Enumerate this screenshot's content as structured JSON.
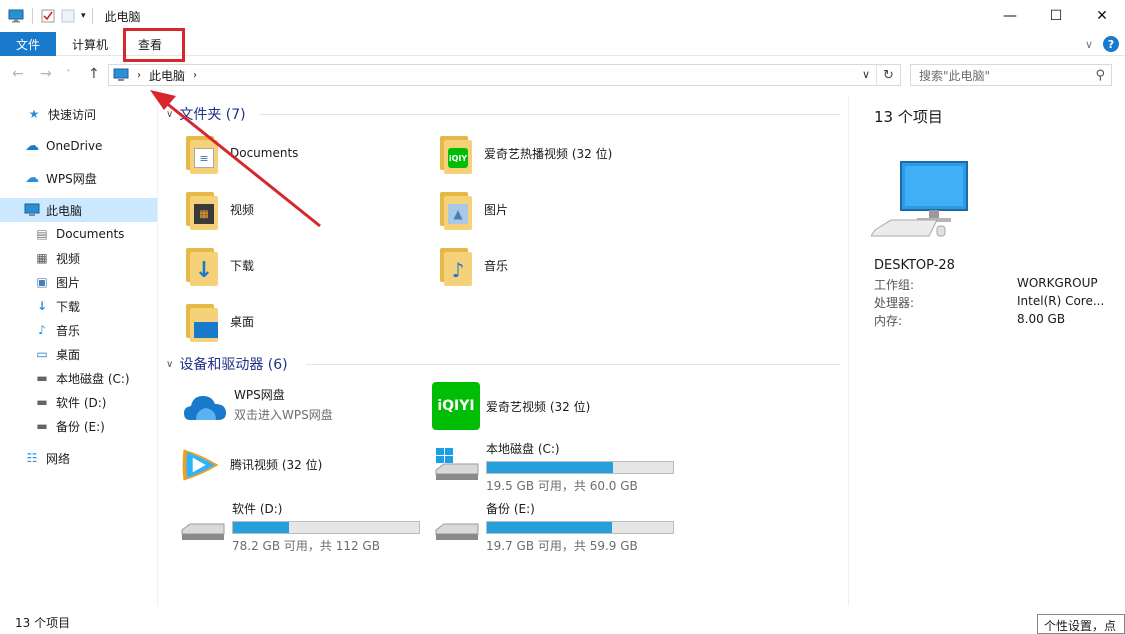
{
  "window": {
    "title": "此电脑"
  },
  "ribbon": {
    "tabs": [
      "文件",
      "计算机",
      "查看"
    ]
  },
  "address": {
    "path": "此电脑",
    "search_placeholder": "搜索\"此电脑\""
  },
  "sidebar": {
    "items": [
      {
        "label": "快速访问",
        "icon": "star-icon"
      },
      {
        "label": "OneDrive",
        "icon": "cloud-icon"
      },
      {
        "label": "WPS网盘",
        "icon": "cloud-icon"
      },
      {
        "label": "此电脑",
        "icon": "computer-icon"
      },
      {
        "label": "Documents",
        "icon": "document-icon"
      },
      {
        "label": "视频",
        "icon": "video-icon"
      },
      {
        "label": "图片",
        "icon": "image-icon"
      },
      {
        "label": "下载",
        "icon": "download-icon"
      },
      {
        "label": "音乐",
        "icon": "music-icon"
      },
      {
        "label": "桌面",
        "icon": "desktop-icon"
      },
      {
        "label": "本地磁盘 (C:)",
        "icon": "drive-icon"
      },
      {
        "label": "软件 (D:)",
        "icon": "drive-icon"
      },
      {
        "label": "备份 (E:)",
        "icon": "drive-icon"
      },
      {
        "label": "网络",
        "icon": "network-icon"
      }
    ]
  },
  "folders": {
    "header": "文件夹 (7)",
    "items": [
      {
        "label": "Documents"
      },
      {
        "label": "爱奇艺热播视频 (32 位)"
      },
      {
        "label": "视频"
      },
      {
        "label": "图片"
      },
      {
        "label": "下载"
      },
      {
        "label": "音乐"
      },
      {
        "label": "桌面"
      }
    ]
  },
  "devices": {
    "header": "设备和驱动器 (6)",
    "wps": {
      "label": "WPS网盘",
      "sub": "双击进入WPS网盘"
    },
    "iqiyi": {
      "label": "爱奇艺视频 (32 位)"
    },
    "tencent": {
      "label": "腾讯视频 (32 位)"
    },
    "drive_c": {
      "label": "本地磁盘 (C:)",
      "sub": "19.5 GB 可用，共 60.0 GB",
      "used_fraction": 0.675
    },
    "drive_d": {
      "label": "软件 (D:)",
      "sub": "78.2 GB 可用，共 112 GB",
      "used_fraction": 0.302
    },
    "drive_e": {
      "label": "备份 (E:)",
      "sub": "19.7 GB 可用，共 59.9 GB",
      "used_fraction": 0.671
    }
  },
  "details": {
    "count": "13 个项目",
    "name": "DESKTOP-28",
    "rows": [
      {
        "key": "工作组:",
        "value": "WORKGROUP"
      },
      {
        "key": "处理器:",
        "value": "Intel(R) Core..."
      },
      {
        "key": "内存:",
        "value": "8.00 GB"
      }
    ]
  },
  "status": {
    "count": "13 个项目",
    "tooltip": "个性设置，点击"
  },
  "colors": {
    "accent": "#1979ca",
    "highlight": "#d7262c",
    "drive_fill": "#26a0da"
  }
}
